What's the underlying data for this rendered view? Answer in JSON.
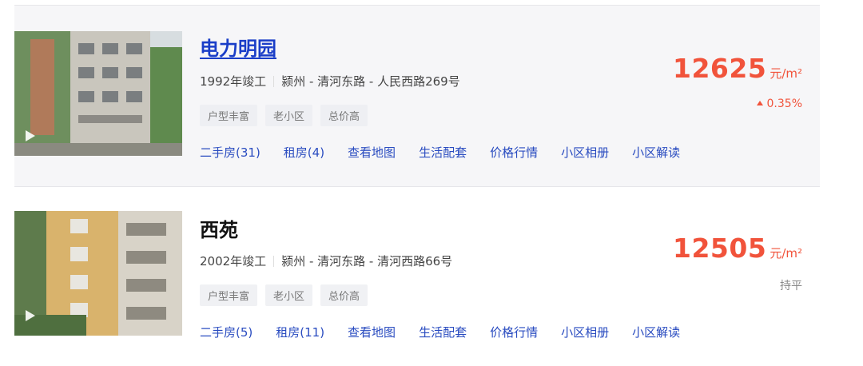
{
  "listings": [
    {
      "name": "电力明园",
      "year": "1992年竣工",
      "location": "颍州 - 清河东路 - 人民西路269号",
      "tags": [
        "户型丰富",
        "老小区",
        "总价高"
      ],
      "links": [
        "二手房(31)",
        "租房(4)",
        "查看地图",
        "生活配套",
        "价格行情",
        "小区相册",
        "小区解读"
      ],
      "price": "12625",
      "unit": "元/m²",
      "change": "0.35%",
      "trend": "up"
    },
    {
      "name": "西苑",
      "year": "2002年竣工",
      "location": "颍州 - 清河东路 - 清河西路66号",
      "tags": [
        "户型丰富",
        "老小区",
        "总价高"
      ],
      "links": [
        "二手房(5)",
        "租房(11)",
        "查看地图",
        "生活配套",
        "价格行情",
        "小区相册",
        "小区解读"
      ],
      "price": "12505",
      "unit": "元/m²",
      "change": "持平",
      "trend": "flat"
    }
  ],
  "colors": {
    "price": "#f1533b",
    "link": "#2a4cc0",
    "title_active": "#1a3ec8"
  }
}
